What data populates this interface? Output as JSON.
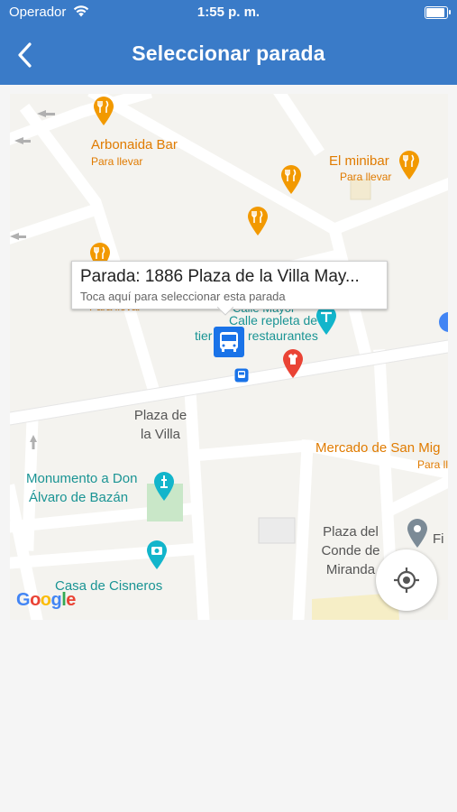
{
  "status_bar": {
    "carrier": "Operador",
    "time": "1:55 p. m.",
    "battery_level": 1.0
  },
  "nav": {
    "title": "Seleccionar parada",
    "back_icon": "chevron-left-icon"
  },
  "map": {
    "places": {
      "arbonaida_name": "Arbonaida Bar",
      "arbonaida_sub": "Para llevar",
      "minibar_name": "El minibar",
      "minibar_sub": "Para llevar",
      "hidden_sub": "Para llevar",
      "calle_mayor": "Calle Mayor",
      "calle_repleta_1": "Calle repleta de",
      "calle_repleta_2_pre": "tier",
      "calle_repleta_2": "restaurantes",
      "plaza_villa_1": "Plaza de",
      "plaza_villa_2": "la Villa",
      "mercado_name": "Mercado de San Mig",
      "mercado_sub": "Para ll",
      "monumento_1": "Monumento a Don",
      "monumento_2": "Álvaro de Bazán",
      "plaza_conde_1": "Plaza del",
      "plaza_conde_2": "Conde de",
      "plaza_conde_3": "Miranda",
      "cisneros": "Casa de Cisneros",
      "fi": "Fi"
    },
    "callout": {
      "title": "Parada: 1886 Plaza de la Villa May...",
      "subtitle": "Toca aquí para seleccionar esta parada"
    },
    "attribution": "Google",
    "colors": {
      "header": "#3a7bc8",
      "restaurant_pin": "#f29900",
      "teal_pin": "#12b5cb",
      "bus_stop": "#1a73e8",
      "red_pin": "#ea4335"
    }
  }
}
